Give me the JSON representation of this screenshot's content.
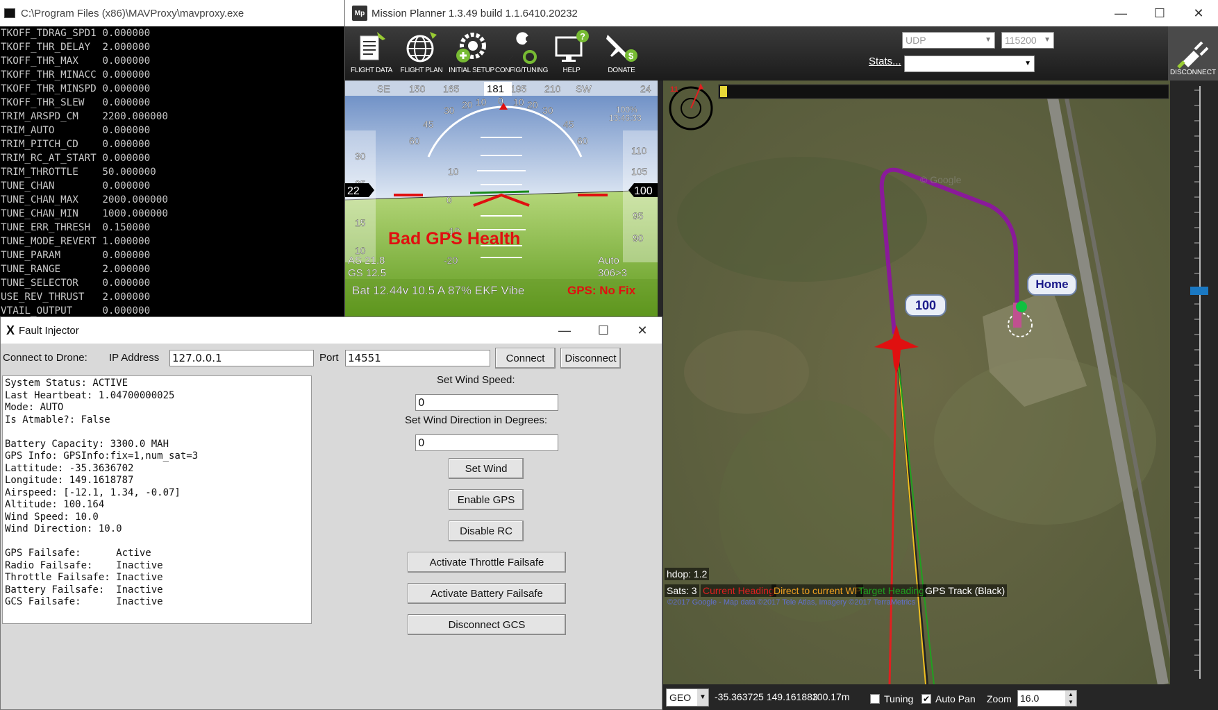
{
  "mavproxy": {
    "title": "C:\\Program Files (x86)\\MAVProxy\\mavproxy.exe",
    "lines": [
      "TKOFF_TDRAG_SPD1 0.000000",
      "TKOFF_THR_DELAY  2.000000",
      "TKOFF_THR_MAX    0.000000",
      "TKOFF_THR_MINACC 0.000000",
      "TKOFF_THR_MINSPD 0.000000",
      "TKOFF_THR_SLEW   0.000000",
      "TRIM_ARSPD_CM    2200.000000",
      "TRIM_AUTO        0.000000",
      "TRIM_PITCH_CD    0.000000",
      "TRIM_RC_AT_START 0.000000",
      "TRIM_THROTTLE    50.000000",
      "TUNE_CHAN        0.000000",
      "TUNE_CHAN_MAX    2000.000000",
      "TUNE_CHAN_MIN    1000.000000",
      "TUNE_ERR_THRESH  0.150000",
      "TUNE_MODE_REVERT 1.000000",
      "TUNE_PARAM       0.000000",
      "TUNE_RANGE       2.000000",
      "TUNE_SELECTOR    0.000000",
      "USE_REV_THRUST   2.000000",
      "VTAIL_OUTPUT     0.000000"
    ]
  },
  "mission_planner": {
    "title": "Mission Planner 1.3.49 build 1.1.6410.20232",
    "logo_text": "Mp",
    "window_controls": {
      "minimize": "—",
      "maximize": "☐",
      "close": "✕"
    },
    "toolbar": [
      {
        "label": "FLIGHT DATA",
        "icon": "flight-data-icon"
      },
      {
        "label": "FLIGHT PLAN",
        "icon": "globe-icon"
      },
      {
        "label": "INITIAL SETUP",
        "icon": "gear-plus-icon"
      },
      {
        "label": "CONFIG/TUNING",
        "icon": "wrench-icon"
      },
      {
        "label": "HELP",
        "icon": "monitor-help-icon"
      },
      {
        "label": "DONATE",
        "icon": "plane-dollar-icon"
      }
    ],
    "connection": {
      "type": "UDP",
      "baud": "115200",
      "stats_label": "Stats...",
      "stats_value": "",
      "disconnect_label": "DISCONNECT"
    },
    "hud": {
      "compass_labels": [
        "SE",
        "150",
        "165",
        "181",
        "195",
        "210",
        "SW",
        "24"
      ],
      "heading_value": "181",
      "roll_labels": [
        "60",
        "45",
        "30",
        "20",
        "10",
        "0",
        "10",
        "20",
        "30",
        "45",
        "60"
      ],
      "pitch_labels": [
        "10",
        "0",
        "-10",
        "-20"
      ],
      "airspeed_ticks": [
        "30",
        "25",
        "15",
        "10"
      ],
      "airspeed_value": "22",
      "altitude_ticks": [
        "110",
        "105",
        "95",
        "90"
      ],
      "altitude_value": "100",
      "battery_remaining_pct": "100%",
      "clock": "13:46:33",
      "message": "Bad GPS Health",
      "as": "AS 21.8",
      "gs": "GS 12.5",
      "mode": "Auto",
      "wp_info": "306>3",
      "status_line": "Bat 12.44v 10.5 A 87% EKF  Vibe",
      "gps_status": "GPS: No Fix",
      "colors": {
        "sky": "#8aa8d4",
        "ground": "#84ba3c",
        "warning": "#e01010"
      }
    },
    "map": {
      "wind_indicator": "11",
      "waypoint_label": "100",
      "home_label": "Home",
      "watermark": "© Google",
      "hdop": "hdop: 1.2",
      "sats": "Sats: 3",
      "legend": [
        {
          "label": "Current Heading",
          "color": "#e02020"
        },
        {
          "label": "Direct to current WP",
          "color": "#f0a020"
        },
        {
          "label": "Target Heading",
          "color": "#20a020"
        },
        {
          "label": "GPS Track (Black)",
          "color": "#ffffff"
        }
      ],
      "copyright": "©2017 Google - Map data ©2017 Tele Atlas, Imagery ©2017 TerraMetrics"
    },
    "status_bar": {
      "coord_system": "GEO",
      "coordinates": "-35.363725 149.161883",
      "altitude": "100.17m",
      "tuning_label": "Tuning",
      "tuning_checked": false,
      "autopan_label": "Auto Pan",
      "autopan_checked": true,
      "zoom_label": "Zoom",
      "zoom_value": "16.0"
    }
  },
  "fault_injector": {
    "title": "Fault Injector",
    "logo": "X",
    "window_controls": {
      "minimize": "—",
      "maximize": "☐",
      "close": "✕"
    },
    "connect_label": "Connect to Drone:",
    "ip_label": "IP Address",
    "ip_value": "127.0.0.1",
    "port_label": "Port",
    "port_value": "14551",
    "connect_button": "Connect",
    "disconnect_button": "Disconnect",
    "status_lines": [
      "System Status: ACTIVE",
      "Last Heartbeat: 1.04700000025",
      "Mode: AUTO",
      "Is Atmable?: False",
      "",
      "Battery Capacity: 3300.0 MAH",
      "GPS Info: GPSInfo:fix=1,num_sat=3",
      "Lattitude: -35.3636702",
      "Longitude: 149.1618787",
      "Airspeed: [-12.1, 1.34, -0.07]",
      "Altitude: 100.164",
      "Wind Speed: 10.0",
      "Wind Direction: 10.0",
      "",
      "GPS Failsafe:      Active",
      "Radio Failsafe:    Inactive",
      "Throttle Failsafe: Inactive",
      "Battery Failsafe:  Inactive",
      "GCS Failsafe:      Inactive"
    ],
    "wind_speed_label": "Set Wind Speed:",
    "wind_speed_value": "0",
    "wind_dir_label": "Set Wind Direction in Degrees:",
    "wind_dir_value": "0",
    "buttons": {
      "set_wind": "Set Wind",
      "enable_gps": "Enable GPS",
      "disable_rc": "Disable RC",
      "throttle_failsafe": "Activate Throttle Failsafe",
      "battery_failsafe": "Activate Battery Failsafe",
      "disconnect_gcs": "Disconnect GCS"
    }
  }
}
